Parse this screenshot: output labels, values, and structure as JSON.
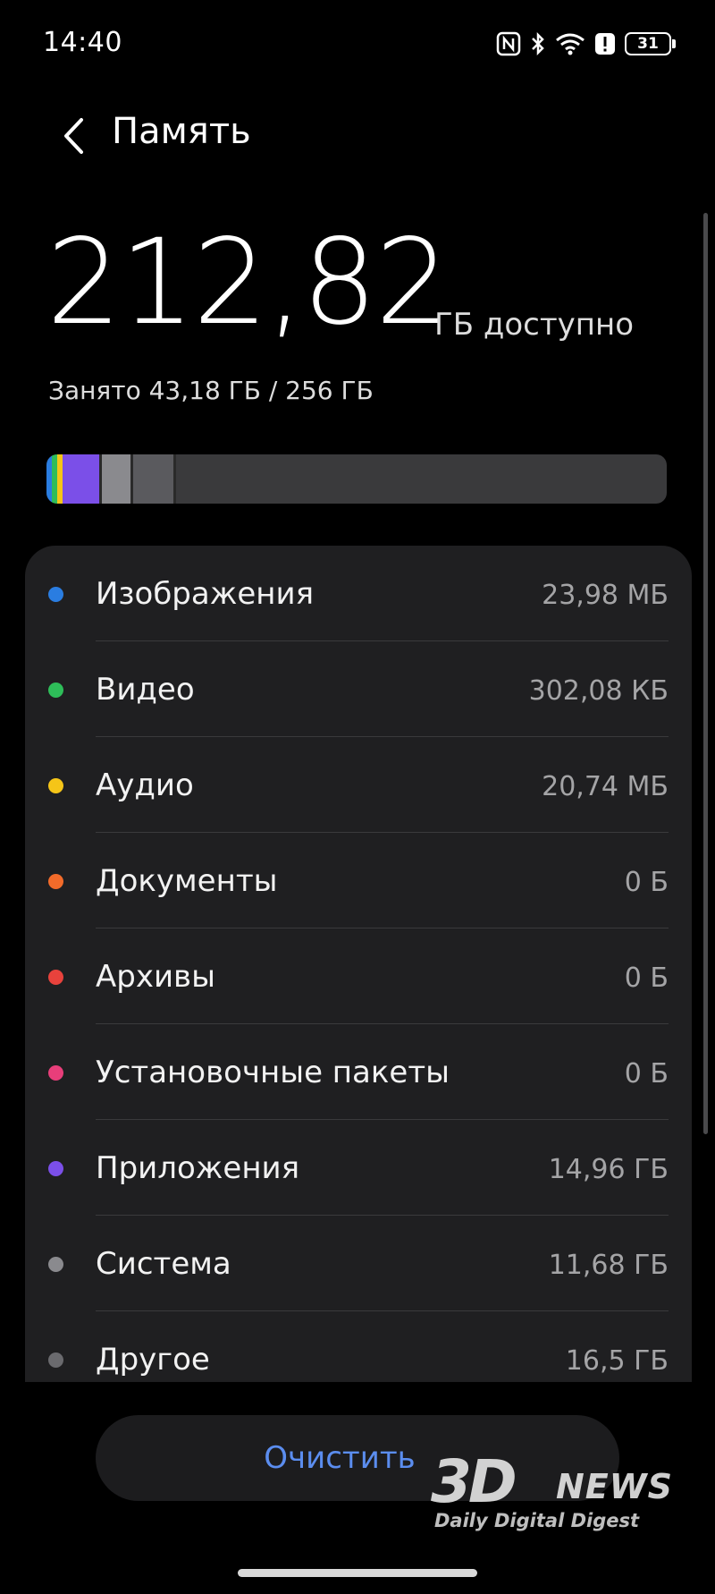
{
  "status_bar": {
    "time": "14:40",
    "icons": [
      "nfc-icon",
      "bluetooth-icon",
      "wifi-icon",
      "alert-icon",
      "battery-icon"
    ],
    "battery_level": "31"
  },
  "header": {
    "back_icon": "chevron-left-icon",
    "title": "Память"
  },
  "summary": {
    "available_value": "212,82",
    "available_unit": "ГБ доступно",
    "used_text": "Занято 43,18 ГБ / 256 ГБ"
  },
  "storage_bar": {
    "segments": [
      {
        "name": "Изображения",
        "color": "#2a7de1",
        "fraction": 0.0007
      },
      {
        "name": "Видео",
        "color": "#2ebd59",
        "fraction": 0.0003
      },
      {
        "name": "Аудио",
        "color": "#f5c518",
        "fraction": 0.0006
      },
      {
        "name": "Приложения",
        "color": "#7b4fe8",
        "fraction": 0.0584
      },
      {
        "name": "Система",
        "color": "#8a8a8e",
        "fraction": 0.0456
      },
      {
        "name": "Другое",
        "color": "#5a5a5e",
        "fraction": 0.0645
      }
    ]
  },
  "categories": [
    {
      "label": "Изображения",
      "value": "23,98 МБ",
      "color": "#2a7de1"
    },
    {
      "label": "Видео",
      "value": "302,08 КБ",
      "color": "#2ebd59"
    },
    {
      "label": "Аудио",
      "value": "20,74 МБ",
      "color": "#f5c518"
    },
    {
      "label": "Документы",
      "value": "0 Б",
      "color": "#f26b2a"
    },
    {
      "label": "Архивы",
      "value": "0 Б",
      "color": "#e8423c"
    },
    {
      "label": "Установочные пакеты",
      "value": "0 Б",
      "color": "#e83e7a"
    },
    {
      "label": "Приложения",
      "value": "14,96 ГБ",
      "color": "#7b4fe8"
    },
    {
      "label": "Система",
      "value": "11,68 ГБ",
      "color": "#8a8a8e"
    },
    {
      "label": "Другое",
      "value": "16,5 ГБ",
      "color": "#6a6a6e"
    }
  ],
  "actions": {
    "clean_label": "Очистить"
  },
  "watermark": {
    "logo": "3D",
    "brand": "NEWS",
    "tagline": "Daily Digital Digest"
  }
}
